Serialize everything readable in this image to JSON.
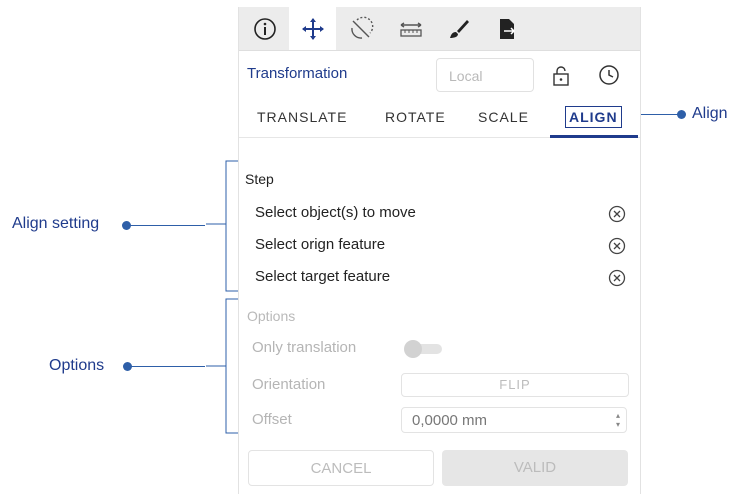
{
  "toolbar": {
    "tools": [
      "info-icon",
      "move-icon",
      "rotate-icon",
      "measure-icon",
      "brush-icon",
      "export-icon"
    ],
    "active_tool": "move-icon"
  },
  "header": {
    "title": "Transformation",
    "frame_select": "Local"
  },
  "tabs": [
    "TRANSLATE",
    "ROTATE",
    "SCALE",
    "ALIGN"
  ],
  "active_tab": "ALIGN",
  "step": {
    "title": "Step",
    "items": [
      "Select object(s) to move",
      "Select orign feature",
      "Select target feature"
    ]
  },
  "options": {
    "title": "Options",
    "only_translation_label": "Only translation",
    "only_translation_on": false,
    "orientation_label": "Orientation",
    "flip_label": "FLIP",
    "offset_label": "Offset",
    "offset_value": "0,0000 mm"
  },
  "buttons": {
    "cancel": "CANCEL",
    "valid": "VALID"
  },
  "annotations": {
    "align": "Align",
    "align_setting": "Align setting",
    "options": "Options"
  },
  "colors": {
    "accent": "#1f3b8c",
    "annotation": "#2e5fa8",
    "disabled_text": "#b9b9b9"
  }
}
